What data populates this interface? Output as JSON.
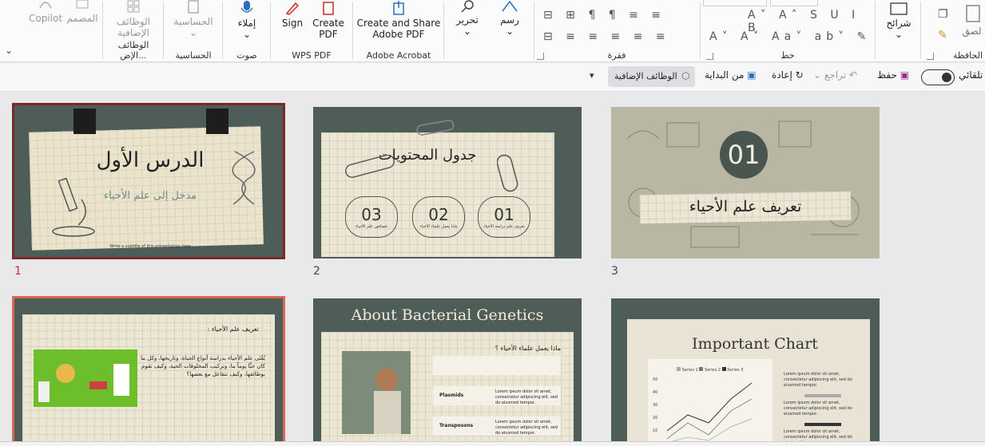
{
  "ribbon": {
    "groups": {
      "clipboard": "الحافظة",
      "font": "خط",
      "paragraph": "فقرة",
      "slides": "شرائح",
      "drawing": "رسم",
      "editing": "تحرير",
      "acrobat": "Adobe Acrobat",
      "wpspdf": "WPS PDF",
      "voice": "صوت",
      "sensitivity": "الحساسية",
      "addins": "الوظائف الإض..."
    },
    "buttons": {
      "paste_partial": "لصق",
      "slides_btn": "شرائح",
      "draw": "رسم",
      "edit": "تحرير",
      "create_share_1": "Create and Share",
      "create_share_2": "Adobe PDF",
      "create_pdf_1": "Create",
      "create_pdf_2": "PDF",
      "sign": "Sign",
      "dictate": "إملاء",
      "sensitivity_btn": "الحساسية",
      "addins_btn_1": "الوظائف",
      "addins_btn_2": "الإضافية",
      "designer": "المصمم",
      "copilot": "Copilot"
    }
  },
  "qat": {
    "autosave_label": "تلقائي",
    "save": "حفظ",
    "undo": "تراجع",
    "redo": "إعادة",
    "from_beginning": "من البداية",
    "addins": "الوظائف الإضافية"
  },
  "slides": [
    {
      "number": "1",
      "title": "الدرس الأول",
      "subtitle": "مدخل إلى علم الأحياء",
      "caption": "Write a subtitle of this presentation here"
    },
    {
      "number": "2",
      "title": "جدول المحتويات",
      "items": [
        {
          "num": "01",
          "text": "تعريف علم دراسة الأحياء"
        },
        {
          "num": "02",
          "text": "ماذا يعمل علماء الأحياء"
        },
        {
          "num": "03",
          "text": "خصائص علم الأحياء"
        }
      ]
    },
    {
      "number": "3",
      "big": "01",
      "title": "تعريف علم الأحياء"
    },
    {
      "number": "",
      "heading": "تعريف علم الأحياء :",
      "body": "يُعْنَى علم الأحياء بدراسة أنواع الحياة، وتاريخها، وكل ما كان حيًّا يوماً ما، وتركيب المخلوقات الحية، وكيف تقوم بوظائفها، وكيف تتفاعل مع بعضها؟"
    },
    {
      "number": "",
      "title": "About Bacterial Genetics",
      "question": "ماذا يعمل علماء الأحياء ؟",
      "rows": [
        "Plasmids",
        "Transposons"
      ],
      "lorem": "Lorem ipsum dolor sit amet, consectetur adipiscing elit, sed do eiusmod tempor."
    },
    {
      "number": "",
      "title": "Important Chart",
      "legend": [
        "Series 1",
        "Series 2",
        "Series 3"
      ],
      "yticks": [
        "50",
        "40",
        "30",
        "20",
        "10"
      ],
      "lorem": "Lorem ipsum dolor sit amet, consectetur adipiscing elit, sed do eiusmod tempor."
    }
  ],
  "colors": {
    "accent": "#c4302b",
    "slide_bg": "#4f5d58",
    "paper": "#ece6d4"
  }
}
